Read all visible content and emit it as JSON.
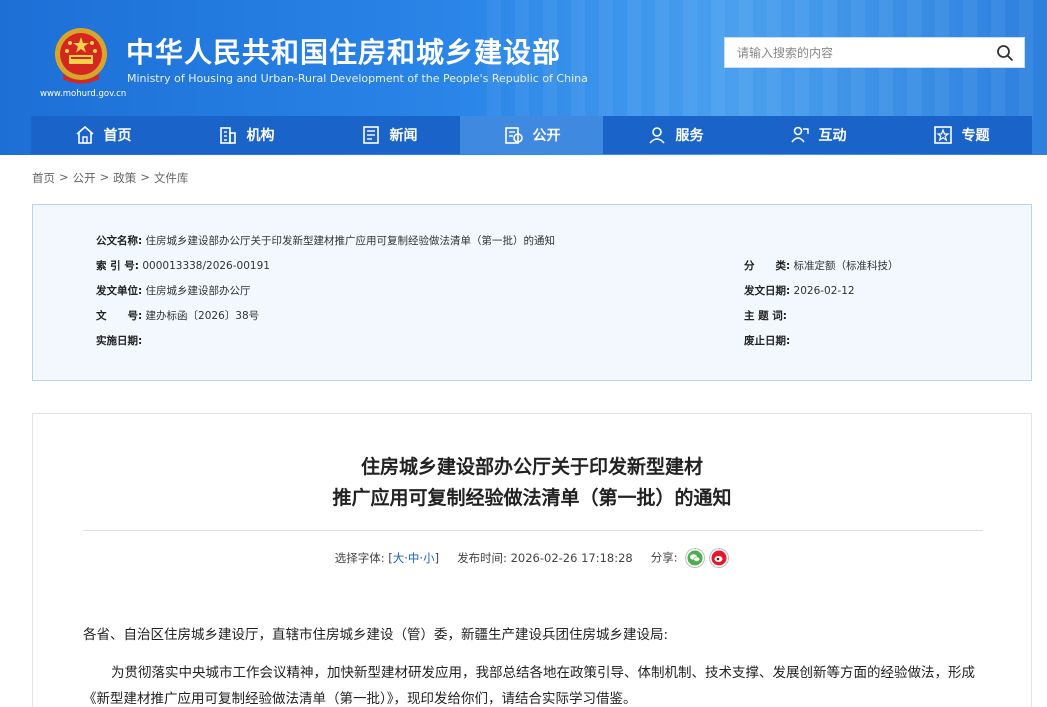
{
  "header": {
    "title_cn": "中华人民共和国住房和城乡建设部",
    "title_en": "Ministry of Housing and Urban-Rural Development of the People's Republic of China",
    "url": "www.mohurd.gov.cn",
    "search_placeholder": "请输入搜索的内容"
  },
  "nav": {
    "items": [
      {
        "label": "首页",
        "icon": "home-icon"
      },
      {
        "label": "机构",
        "icon": "building-icon"
      },
      {
        "label": "新闻",
        "icon": "news-icon"
      },
      {
        "label": "公开",
        "icon": "disclosure-icon"
      },
      {
        "label": "服务",
        "icon": "service-icon"
      },
      {
        "label": "互动",
        "icon": "interaction-icon"
      },
      {
        "label": "专题",
        "icon": "topic-icon"
      }
    ],
    "active_index": 3
  },
  "breadcrumb": [
    "首页",
    "公开",
    "政策",
    "文件库"
  ],
  "info": {
    "title_label": "公文名称:",
    "title_value": "住房城乡建设部办公厅关于印发新型建材推广应用可复制经验做法清单（第一批）的通知",
    "index_label": "索 引 号:",
    "index_value": "000013338/2026-00191",
    "category_label": "分　　类:",
    "category_value": "标准定额（标准科技）",
    "issuer_label": "发文单位:",
    "issuer_value": "住房城乡建设部办公厅",
    "date_label": "发文日期:",
    "date_value": "2026-02-12",
    "docno_label": "文　　号:",
    "docno_value": "建办标函〔2026〕38号",
    "subject_label": "主 题 词:",
    "subject_value": "",
    "effective_label": "实施日期:",
    "effective_value": "",
    "expiry_label": "废止日期:",
    "expiry_value": ""
  },
  "article": {
    "title_line1": "住房城乡建设部办公厅关于印发新型建材",
    "title_line2": "推广应用可复制经验做法清单（第一批）的通知",
    "font_select_label": "选择字体:",
    "font_large": "大",
    "font_medium": "中",
    "font_small": "小",
    "publish_label": "发布时间:",
    "publish_time": "2026-02-26 17:18:28",
    "share_label": "分享:",
    "salutation": "各省、自治区住房城乡建设厅，直辖市住房城乡建设（管）委，新疆生产建设兵团住房城乡建设局:",
    "body_p1_line1": "为贯彻落实中央城市工作会议精神，加快新型建材研发应用，我部总结各地在政策引导、体制机制、技术支撑、发展创新等方面的经验做法，形成",
    "body_p1_line2": "《新型建材推广应用可复制经验做法清单（第一批）》，现印发给你们，请结合实际学习借鉴。"
  },
  "colors": {
    "header_blue": "#2a86e8",
    "nav_blue": "#1a63c9",
    "nav_active": "#3f89e0",
    "panel_bg": "#f2f8fd",
    "wechat_green": "#4cae4c",
    "weibo_red": "#e6162d"
  }
}
